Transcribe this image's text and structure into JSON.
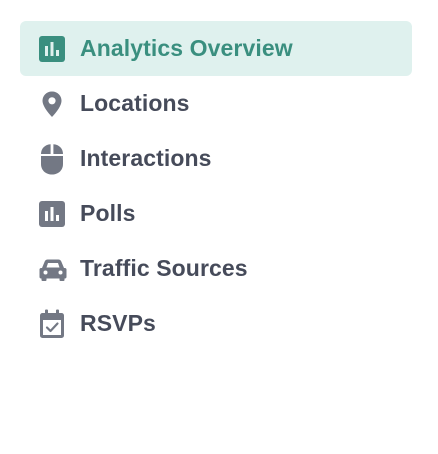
{
  "colors": {
    "active_bg": "#dff1ee",
    "active_text": "#3a8f7f",
    "text": "#464b5a",
    "icon": "#737884"
  },
  "nav": {
    "items": [
      {
        "label": "Analytics Overview",
        "icon": "bar-chart-icon",
        "active": true
      },
      {
        "label": "Locations",
        "icon": "map-pin-icon",
        "active": false
      },
      {
        "label": "Interactions",
        "icon": "mouse-icon",
        "active": false
      },
      {
        "label": "Polls",
        "icon": "bar-chart-icon",
        "active": false
      },
      {
        "label": "Traffic Sources",
        "icon": "car-icon",
        "active": false
      },
      {
        "label": "RSVPs",
        "icon": "calendar-check-icon",
        "active": false
      }
    ]
  }
}
